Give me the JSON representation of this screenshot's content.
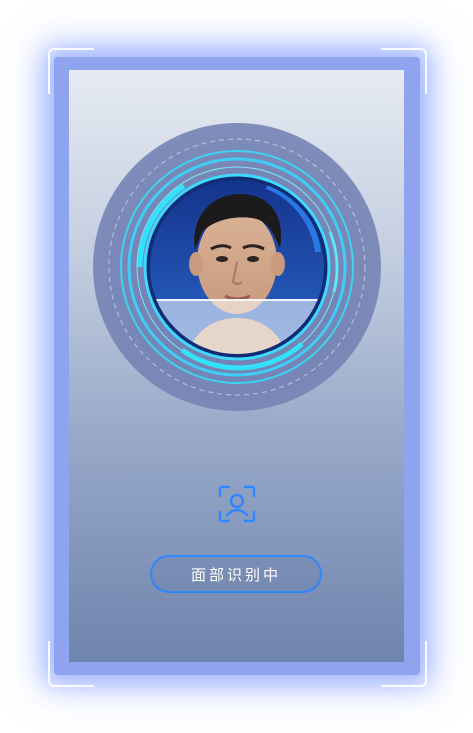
{
  "status": {
    "label": "面部识别中"
  },
  "icons": {
    "scanner": "face-scanner-ring",
    "face_id": "face-recognition-icon"
  },
  "colors": {
    "accent": "#2f86ff",
    "ring_cyan": "#2ee6ff",
    "frame_glow": "#8fa4ee"
  }
}
